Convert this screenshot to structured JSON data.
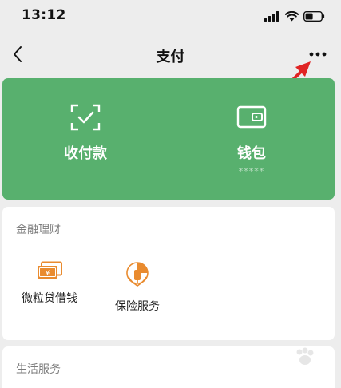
{
  "status_bar": {
    "time": "13:12"
  },
  "nav": {
    "title": "支付"
  },
  "pay_card": {
    "bg_color": "#58b06e",
    "items": [
      {
        "label": "收付款",
        "icon": "scan-payment-icon"
      },
      {
        "label": "钱包",
        "sub": "*****",
        "icon": "wallet-icon"
      }
    ]
  },
  "finance": {
    "title": "金融理财",
    "services": [
      {
        "label": "微粒贷借钱",
        "icon": "loan-money-icon",
        "color": "#e98b2f"
      },
      {
        "label": "保险服务",
        "icon": "insurance-icon",
        "color": "#e98b2f"
      }
    ]
  },
  "life": {
    "title": "生活服务"
  },
  "annotation": {
    "arrow_color": "#e02424"
  }
}
